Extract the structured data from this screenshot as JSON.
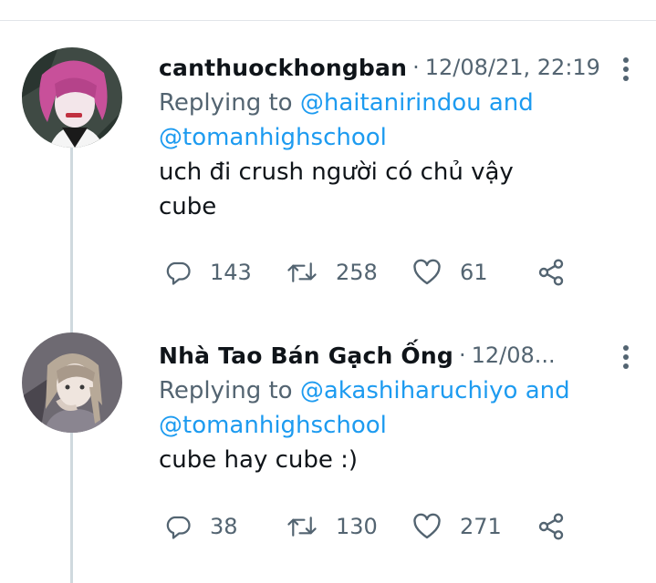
{
  "tweets": [
    {
      "username": "canthuockhongban",
      "separator": "·",
      "timestamp": "12/08/21, 22:19",
      "replying_prefix": "Replying to",
      "mention_1": "@haitanirindou",
      "and_word": "and",
      "mention_2": "@tomanhighschool",
      "text_line_1": "uch đi crush người có chủ vậy",
      "text_line_2": "cube",
      "replies": "143",
      "retweets": "258",
      "likes": "61"
    },
    {
      "username": "Nhà Tao Bán Gạch Ống",
      "separator": "·",
      "timestamp": "12/08...",
      "replying_prefix": "Replying to",
      "mention_1": "@akashiharuchiyo",
      "and_word": "and",
      "mention_2": "@tomanhighschool",
      "text_line_1": "cube hay cube :)",
      "replies": "38",
      "retweets": "130",
      "likes": "271"
    }
  ],
  "icons": {
    "reply": "reply-icon",
    "retweet": "retweet-icon",
    "like": "heart-icon",
    "share": "share-icon",
    "more": "more-vertical-icon"
  },
  "colors": {
    "text": "#0f1419",
    "secondary": "#536471",
    "mention": "#1d9bf0",
    "thread_line": "#cfd9de"
  }
}
